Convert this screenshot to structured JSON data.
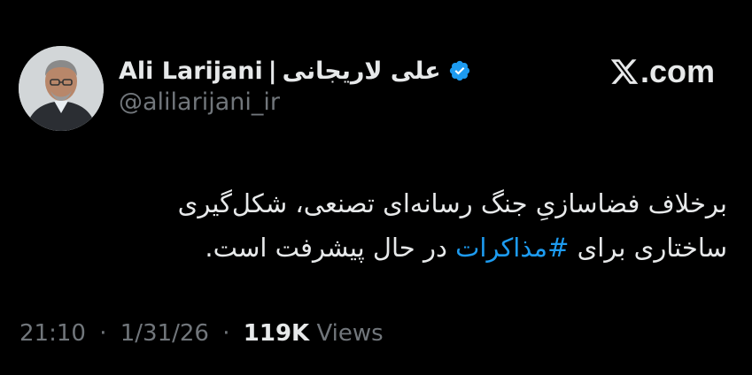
{
  "author": {
    "display_name_en": "Ali Larijani",
    "separator": "|",
    "display_name_fa": "علی لاریجانی",
    "handle": "@alilarijani_ir",
    "verified": true,
    "avatar_icon": "profile-photo"
  },
  "brand": {
    "logo_icon": "x-logo-icon",
    "logo_text": ".com"
  },
  "tweet": {
    "text_line1": "برخلاف فضاسازیِ جنگ رسانه‌ای تصنعی، شکل‌گیری",
    "text_line2_part1": "ساختاری برای ",
    "hashtag": "#مذاکرات",
    "text_line2_part2": " در حال پیشرفت است."
  },
  "meta": {
    "time": "21:10",
    "dot1": "·",
    "date": "1/31/26",
    "dot2": "·",
    "views_count": "119K",
    "views_label": "Views"
  },
  "colors": {
    "background": "#000000",
    "text": "#e7e9ea",
    "secondary": "#71767b",
    "accent": "#1d9bf0"
  }
}
